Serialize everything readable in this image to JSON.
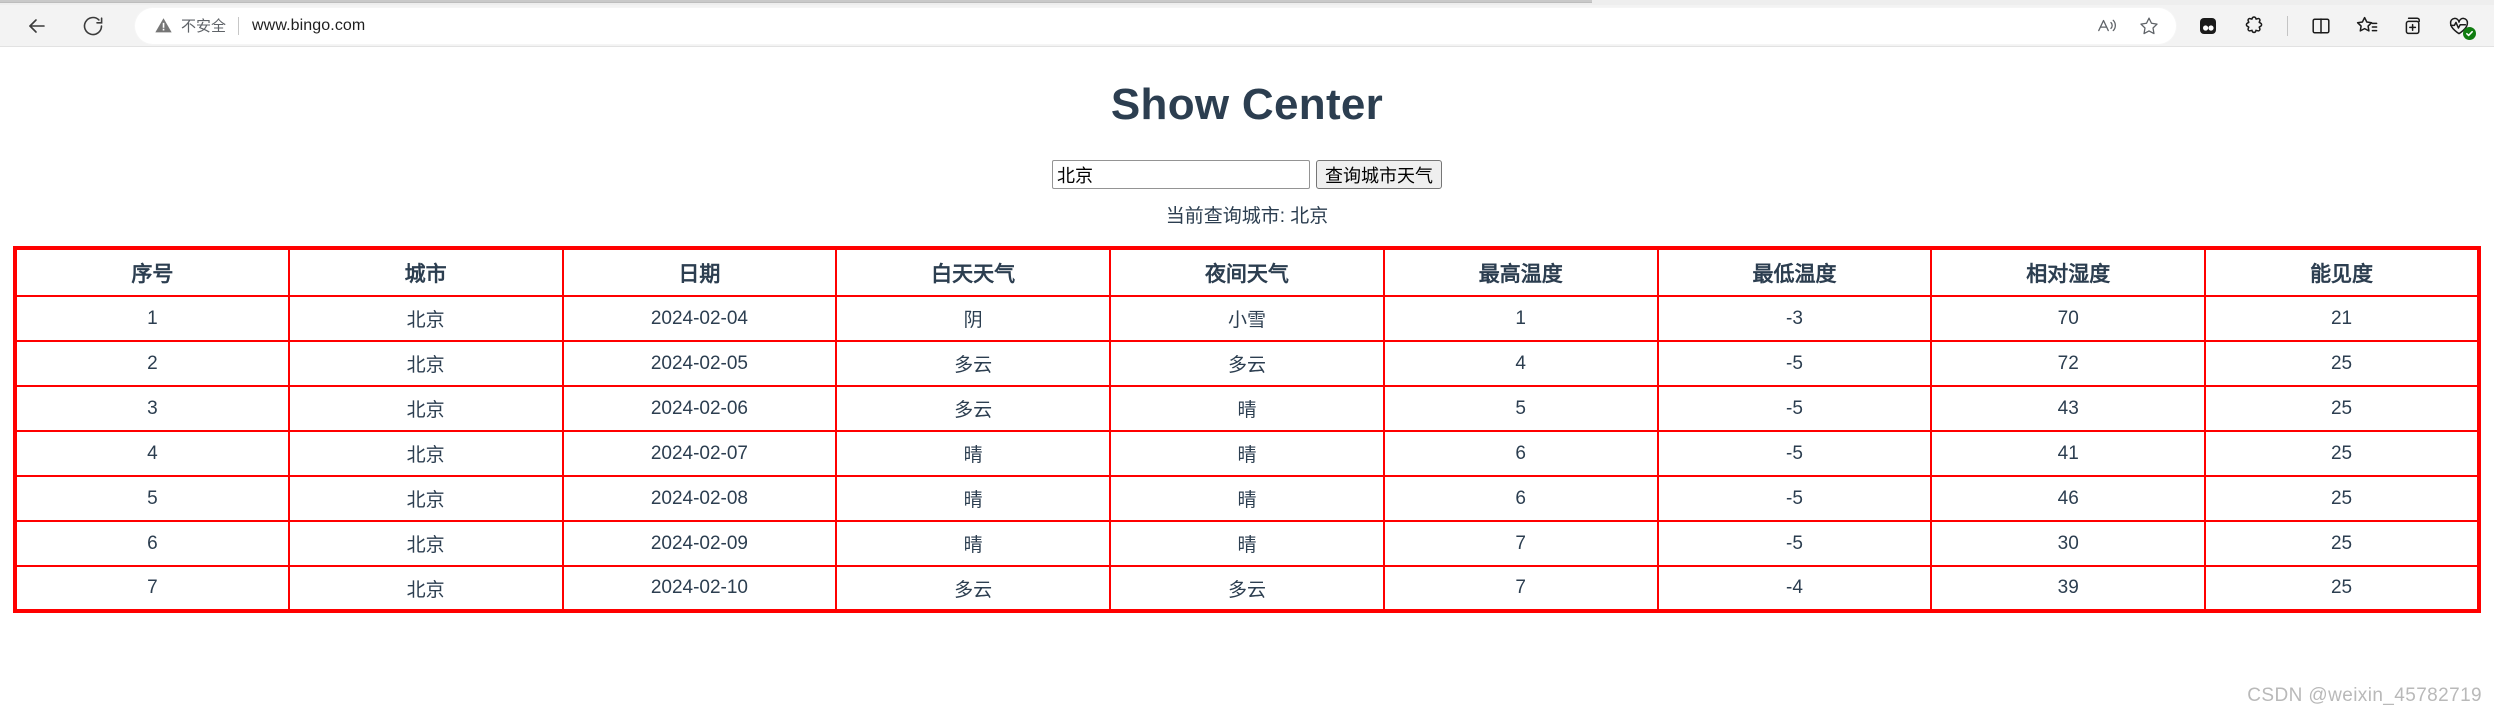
{
  "browser": {
    "back_icon": "back-arrow-icon",
    "reload_icon": "reload-icon",
    "security_label": "不安全",
    "security_icon": "warning-triangle-icon",
    "url": "www.bingo.com",
    "address_icons": [
      {
        "name": "read-aloud-icon",
        "label": "朗读此页面"
      },
      {
        "name": "favorite-star-icon",
        "label": "将此页面添加到收藏夹"
      }
    ],
    "toolbar_icons": [
      {
        "name": "browser-essentials-icon",
        "label": "浏览器基本功能"
      },
      {
        "name": "extensions-icon",
        "label": "扩展"
      },
      {
        "name": "split-screen-icon",
        "label": "拆分屏幕"
      },
      {
        "name": "collections-icon",
        "label": "集锦"
      },
      {
        "name": "tab-actions-icon",
        "label": "标签页操作菜单"
      },
      {
        "name": "performance-icon",
        "label": "性能"
      }
    ]
  },
  "page": {
    "title": "Show Center",
    "search": {
      "input_value": "北京",
      "input_placeholder": "",
      "button_label": "查询城市天气"
    },
    "current_city_text": "当前查询城市: 北京",
    "watermark": "CSDN @weixin_45782719"
  },
  "table": {
    "headers": [
      "序号",
      "城市",
      "日期",
      "白天天气",
      "夜间天气",
      "最高温度",
      "最低温度",
      "相对湿度",
      "能见度"
    ],
    "rows": [
      [
        "1",
        "北京",
        "2024-02-04",
        "阴",
        "小雪",
        "1",
        "-3",
        "70",
        "21"
      ],
      [
        "2",
        "北京",
        "2024-02-05",
        "多云",
        "多云",
        "4",
        "-5",
        "72",
        "25"
      ],
      [
        "3",
        "北京",
        "2024-02-06",
        "多云",
        "晴",
        "5",
        "-5",
        "43",
        "25"
      ],
      [
        "4",
        "北京",
        "2024-02-07",
        "晴",
        "晴",
        "6",
        "-5",
        "41",
        "25"
      ],
      [
        "5",
        "北京",
        "2024-02-08",
        "晴",
        "晴",
        "6",
        "-5",
        "46",
        "25"
      ],
      [
        "6",
        "北京",
        "2024-02-09",
        "晴",
        "晴",
        "7",
        "-5",
        "30",
        "25"
      ],
      [
        "7",
        "北京",
        "2024-02-10",
        "多云",
        "多云",
        "7",
        "-4",
        "39",
        "25"
      ]
    ]
  },
  "colors": {
    "table_border": "#ff0000",
    "title_text": "#2c3e50",
    "page_bg": "#ffffff",
    "toolbar_bg": "#f3f3f3"
  }
}
